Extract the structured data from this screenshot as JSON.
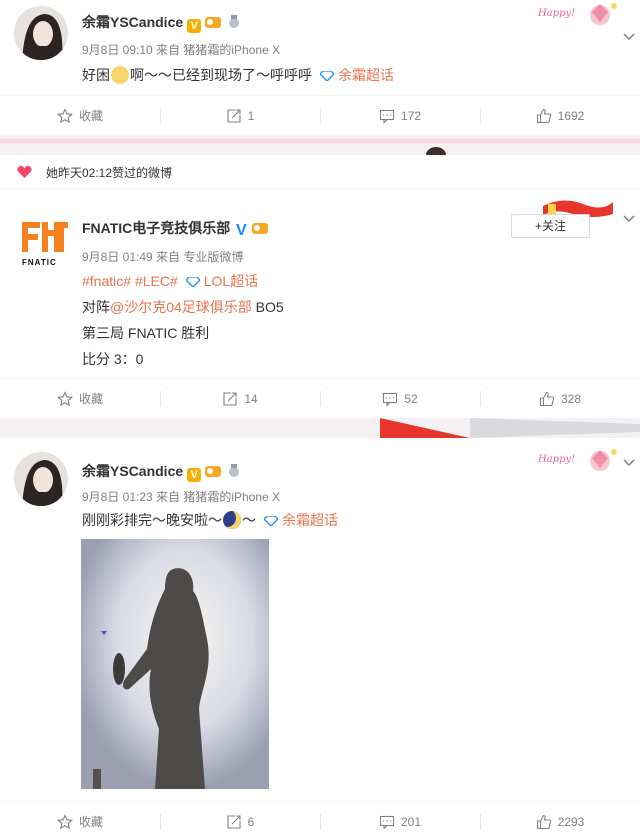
{
  "post1": {
    "username": "余霜YSCandice",
    "meta": "9月8日 09:10 来自 猪猪霜的iPhone X",
    "text": "好困",
    "text2": "啊～～已经到现场了～呼呼呼",
    "topic": "余霜超话",
    "actions": {
      "fav": "收藏",
      "repost": "1",
      "comment": "172",
      "like": "1692"
    }
  },
  "liked_notice": "她昨天02:12赞过的微博",
  "post2": {
    "username": "FNATIC电子竞技俱乐部",
    "meta": "9月8日 01:49 来自 专业版微博",
    "tag1": "#fnatic#",
    "tag2": "#LEC#",
    "topic": "LOL超话",
    "line2_prefix": "对阵",
    "line2_link": "@沙尔克04足球俱乐部",
    "line2_suffix": " BO5",
    "line3": "第三局 FNATIC 胜利",
    "line4": "比分 3：0",
    "follow": "+关注",
    "logo_text": "FNATIC",
    "actions": {
      "fav": "收藏",
      "repost": "14",
      "comment": "52",
      "like": "328"
    }
  },
  "post3": {
    "username": "余霜YSCandice",
    "meta": "9月8日 01:23 来自 猪猪霜的iPhone X",
    "text": "刚刚彩排完～晚安啦～",
    "text2": "～",
    "topic": "余霜超话",
    "actions": {
      "fav": "收藏",
      "repost": "6",
      "comment": "201",
      "like": "2293"
    }
  },
  "badges": {
    "happy": "Happy!",
    "v": "V"
  },
  "colors": {
    "accent": "#eb7350",
    "meta": "#808080",
    "topic": "#1a8bff"
  }
}
